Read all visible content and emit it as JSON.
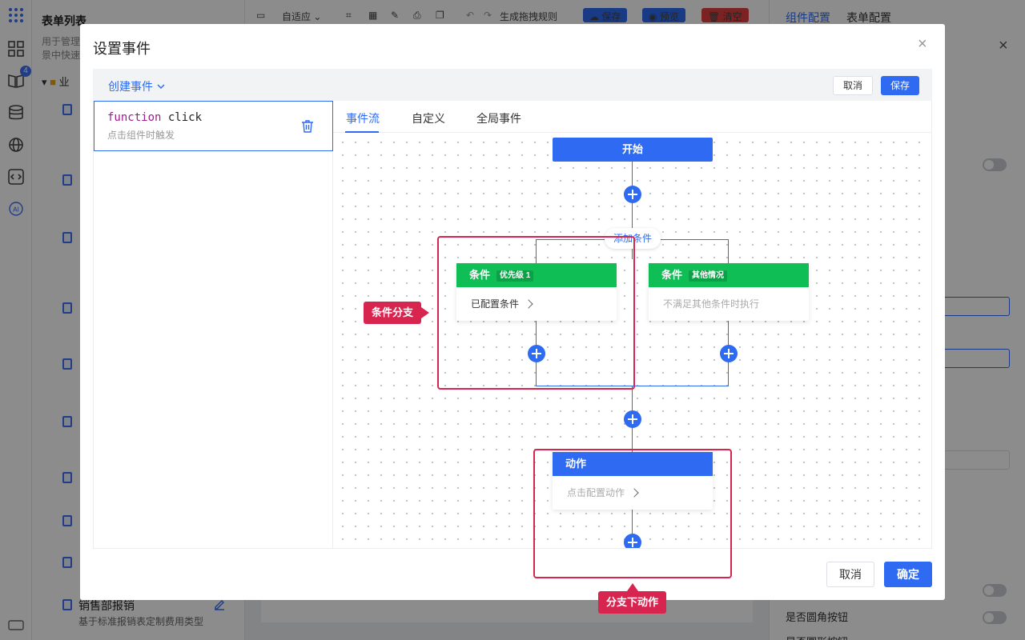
{
  "background": {
    "tree": {
      "title": "表单列表",
      "desc_line1": "用于管理",
      "desc_line2": "景中快速",
      "folder_label": "业",
      "bottom_item_title": "销售部报销",
      "bottom_item_desc": "基于标准报销表定制费用类型"
    },
    "rail": {
      "badge": "4",
      "ai_label": "AI"
    },
    "toolbar": {
      "adaptive": "自适应",
      "gen_rules": "生成拖拽规则",
      "save": "保存",
      "preview": "预览",
      "clear": "清空"
    },
    "right_panel": {
      "tab_component": "组件配置",
      "tab_form": "表单配置",
      "rounded_button": "是否圆角按钮",
      "circle_button": "是否圆形按钮"
    }
  },
  "modal": {
    "title": "设置事件",
    "create_event": "创建事件",
    "bar_cancel": "取消",
    "bar_save": "保存",
    "event": {
      "keyword": "function",
      "name": "click",
      "desc": "点击组件时触发"
    },
    "tabs": [
      "事件流",
      "自定义",
      "全局事件"
    ],
    "flow": {
      "start": "开始",
      "add_condition": "添加条件",
      "cond1_title": "条件",
      "cond1_tag": "优先级 1",
      "cond1_body": "已配置条件",
      "cond2_title": "条件",
      "cond2_tag": "其他情况",
      "cond2_body": "不满足其他条件时执行",
      "action_title": "动作",
      "action_body": "点击配置动作"
    },
    "annotations": {
      "branch": "条件分支",
      "branch_action": "分支下动作"
    },
    "footer": {
      "cancel": "取消",
      "ok": "确定"
    }
  },
  "colors": {
    "primary": "#2f6bf2",
    "condition_green": "#0fbe54",
    "annotation_red": "#d8254f",
    "danger": "#e04040"
  }
}
